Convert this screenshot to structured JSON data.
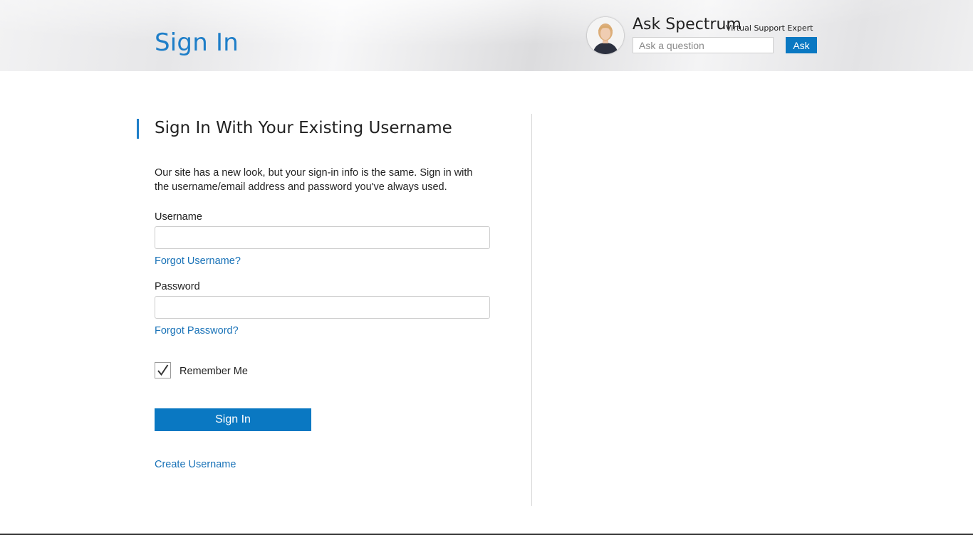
{
  "header": {
    "page_title": "Sign In",
    "assistant": {
      "name": "Ask Spectrum",
      "subtitle": "Virtual Support Expert",
      "input_placeholder": "Ask a question",
      "button_label": "Ask",
      "avatar_icon": "support-agent-avatar"
    }
  },
  "form": {
    "heading": "Sign In With Your Existing Username",
    "intro": "Our site has a new look, but your sign-in info is the same. Sign in with the username/email address and password you've always used.",
    "username_label": "Username",
    "username_value": "",
    "forgot_username": "Forgot Username?",
    "password_label": "Password",
    "password_value": "",
    "forgot_password": "Forgot Password?",
    "remember_me_label": "Remember Me",
    "remember_me_checked": true,
    "submit_label": "Sign In",
    "create_username": "Create Username"
  },
  "colors": {
    "accent": "#0a78c2",
    "title_blue": "#1e7ec8",
    "link": "#1a73b8"
  }
}
